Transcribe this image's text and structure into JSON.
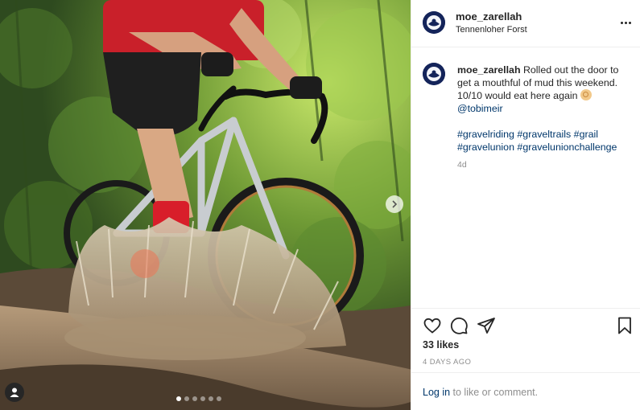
{
  "post": {
    "username": "moe_zarellah",
    "location": "Tennenloher Forst",
    "caption_text": "Rolled out the door to get a mouthful of mud this weekend. 10/10 would eat here again",
    "mention": "@tobimeir",
    "hashtags": [
      "#gravelriding",
      "#graveltrails",
      "#grail",
      "#gravelunion",
      "#gravelunionchallenge"
    ],
    "relative_time": "4d",
    "likes": "33 likes",
    "date": "4 DAYS AGO"
  },
  "login": {
    "link": "Log in",
    "rest": " to like or comment."
  },
  "carousel": {
    "slides": 6,
    "active": 1
  },
  "icons": {
    "like": "heart-icon",
    "comment": "comment-icon",
    "share": "paper-plane-icon",
    "save": "bookmark-icon",
    "more": "more-options-icon",
    "next": "chevron-right-icon",
    "tags": "user-tag-icon"
  },
  "colors": {
    "link": "#00376b",
    "muted": "#8e8e8e",
    "text": "#262626",
    "border": "#efefef"
  }
}
